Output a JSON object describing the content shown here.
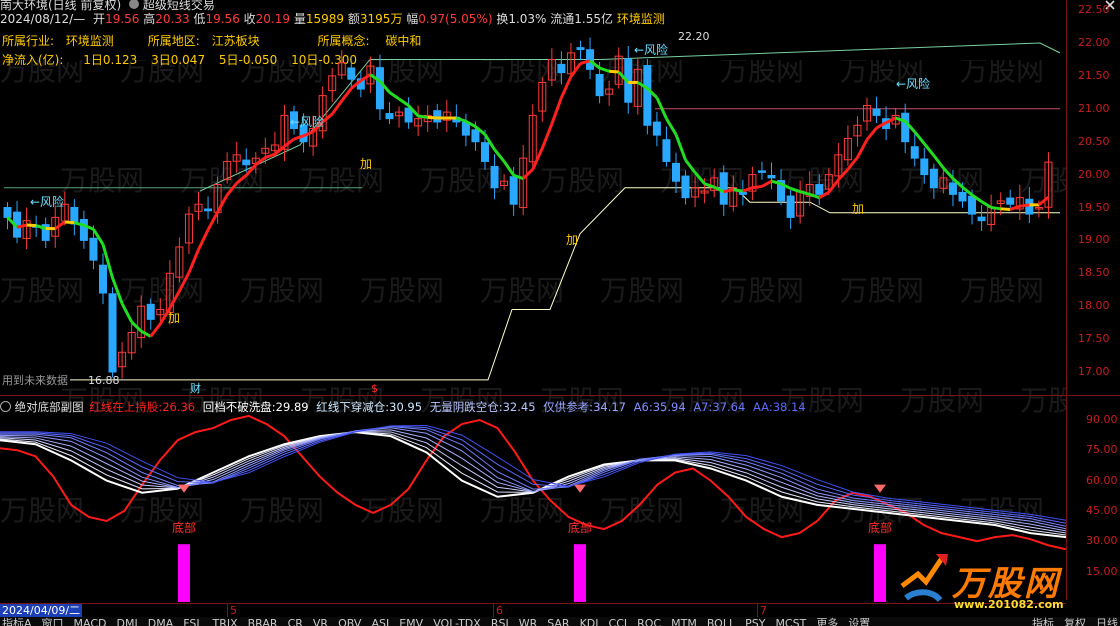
{
  "top_bar": {
    "stock_name": "南大环境(日线 前复权)",
    "strategy": "超级短线交易",
    "close_icon": "close-icon"
  },
  "quote": {
    "date": "2024/08/12/—",
    "open_label": "开",
    "open": "19.56",
    "high_label": "高",
    "high": "20.33",
    "low_label": "低",
    "low": "19.56",
    "close_label": "收",
    "close": "20.19",
    "volume_label": "量",
    "volume": "15989",
    "amount_label": "额",
    "amount": "3195万",
    "change_label": "幅",
    "change": "0.97(5.05%)",
    "turnover": "换1.03%",
    "float": "流通1.55亿",
    "concept_tag": "环境监测"
  },
  "info": {
    "industry_label": "所属行业:",
    "industry": "环境监测",
    "region_label": "所属地区:",
    "region": "江苏板块",
    "concept_label": "所属概念:",
    "concept": "碳中和"
  },
  "inflow": {
    "label": "净流入(亿):",
    "d1_label": "1日",
    "d1": "0.123",
    "d3_label": "3日",
    "d3": "0.047",
    "d5_label": "5日",
    "d5": "-0.050",
    "d10_label": "10日",
    "d10": "-0.300"
  },
  "price_axis": [
    "22.00",
    "21.50",
    "21.00",
    "20.50",
    "20.00",
    "19.50",
    "19.00",
    "18.50",
    "18.00",
    "17.50",
    "17.00"
  ],
  "price_top_partial": "22.50",
  "annotations": {
    "risk": "←风险",
    "add": "加",
    "high_price": "22.20",
    "low_price": "16.88",
    "future_text": "用到未来数据",
    "finance": "财",
    "event": "$"
  },
  "indicator": {
    "name": "绝对底部副图",
    "red_label": "红线在上持股:",
    "red_value": "26.36",
    "pullback_label": "回档不破洗盘:",
    "pullback_value": "29.89",
    "cross_label": "红线下穿减仓:",
    "cross_value": "30.95",
    "clear_label": "无量阴跌空仓:",
    "clear_value": "32.45",
    "ref_label": "仅供参考:",
    "ref_value": "34.17",
    "a6_label": "A6:",
    "a6": "35.94",
    "a7_label": "A7:",
    "a7": "37.64",
    "aa_label": "AA:",
    "aa": "38.14",
    "bottom_label": "底部",
    "axis": [
      "90.00",
      "75.00",
      "60.00",
      "45.00",
      "30.00",
      "15.00"
    ]
  },
  "time_axis": {
    "start_date": "2024/04/09/二",
    "months": [
      "5",
      "6",
      "7"
    ]
  },
  "bottom_tabs": [
    "指标A",
    "窗口",
    "MACD",
    "DMI",
    "DMA",
    "FSL",
    "TRIX",
    "BRAR",
    "CR",
    "VR",
    "OBV",
    "ASI",
    "EMV",
    "VOL-TDX",
    "RSI",
    "WR",
    "SAR",
    "KDJ",
    "CCI",
    "ROC",
    "MTM",
    "BOLL",
    "PSY",
    "MCST",
    "更多",
    "设置"
  ],
  "bottom_right": [
    "指标",
    "复权",
    "日线"
  ],
  "watermark": {
    "brand": "万股网",
    "site": "www.201082.com"
  },
  "colors": {
    "up": "#ff3b3b",
    "down": "#2aa8ff",
    "ma_red": "#ff2020",
    "ma_green": "#22dd22",
    "ma_yellow": "#ffcc00",
    "axis_red": "#c81e1e",
    "magenta": "#ff00ff"
  }
}
